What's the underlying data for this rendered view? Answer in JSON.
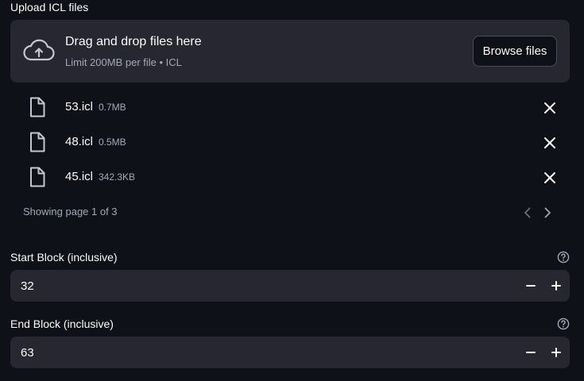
{
  "uploader": {
    "label": "Upload ICL files",
    "drop_title": "Drag and drop files here",
    "drop_limit": "Limit 200MB per file • ICL",
    "browse_label": "Browse files",
    "icon": "cloud-upload-icon"
  },
  "files": [
    {
      "name": "53.icl",
      "size": "0.7MB"
    },
    {
      "name": "48.icl",
      "size": "0.5MB"
    },
    {
      "name": "45.icl",
      "size": "342.3KB"
    }
  ],
  "pagination": {
    "text": "Showing page 1 of 3",
    "current_page": 1,
    "total_pages": 3
  },
  "start_block": {
    "label": "Start Block (inclusive)",
    "value": "32"
  },
  "end_block": {
    "label": "End Block (inclusive)",
    "value": "63"
  },
  "colors": {
    "background": "#0e1117",
    "surface": "#262730",
    "text": "#fafafa",
    "muted": "#a3a8b8"
  }
}
